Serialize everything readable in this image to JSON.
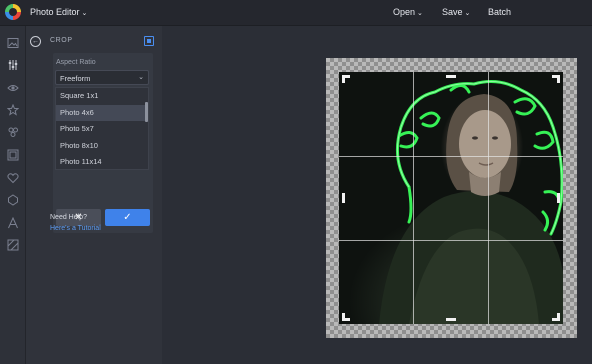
{
  "app": {
    "title": "Photo Editor"
  },
  "topmenu": {
    "open": "Open",
    "save": "Save",
    "batch": "Batch"
  },
  "panel": {
    "title": "CROP",
    "aspect_label": "Aspect Ratio",
    "aspect_value": "Freeform",
    "options": [
      "Square 1x1",
      "Photo 4x6",
      "Photo 5x7",
      "Photo 8x10",
      "Photo 11x14"
    ],
    "selected_option": "Photo 4x6",
    "cancel_glyph": "✕",
    "apply_glyph": "✓",
    "help_label": "Need Help?",
    "help_link": "Here's a Tutorial"
  },
  "colors": {
    "accent": "#3f82ea",
    "link": "#5e9cf2",
    "neon": "#39ff5a"
  },
  "rail_icons": [
    "image-icon",
    "sliders-icon",
    "eye-icon",
    "star-icon",
    "graphics-icon",
    "frame-icon",
    "heart-icon",
    "shape-icon",
    "text-icon",
    "texture-icon"
  ]
}
